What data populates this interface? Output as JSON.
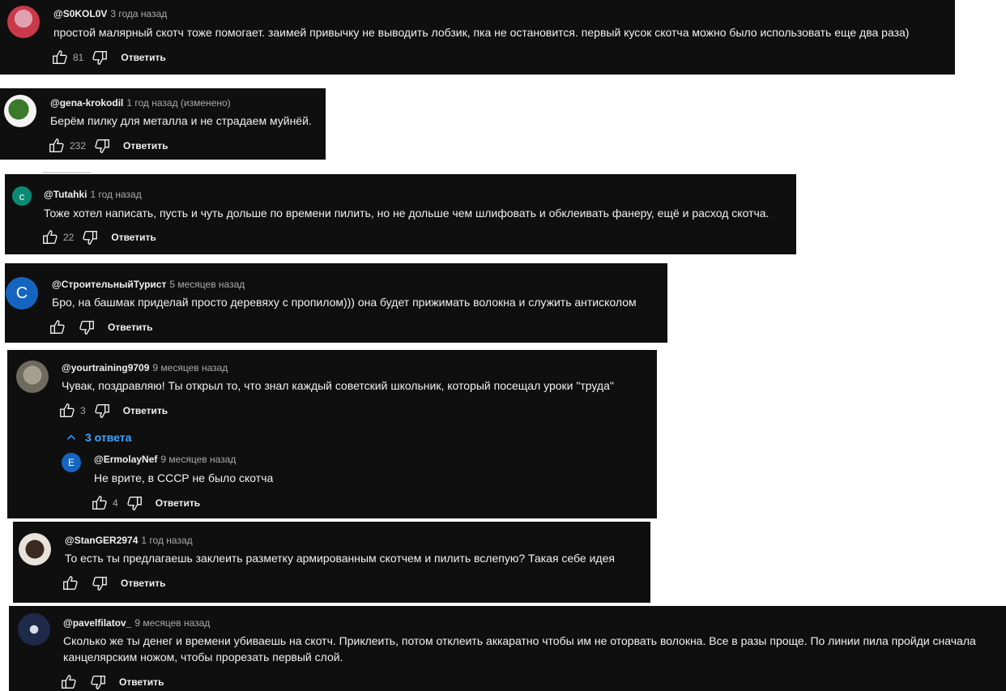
{
  "ui": {
    "reply_label": "Ответить",
    "accent": "#3ea6ff",
    "card_bg": "#0f0f0f"
  },
  "comments": [
    {
      "author": "@S0KOL0V",
      "time": "3 года назад",
      "text": "простой малярный скотч тоже помогает. заимей привычку не выводить лобзик, пка не остановится. первый кусок скотча можно было использовать еще два раза)",
      "likes": "81",
      "avatar": {
        "type": "photo",
        "colors": [
          "#c83a4a",
          "#e0a0b0"
        ]
      }
    },
    {
      "author": "@gena-krokodil",
      "time": "1 год назад (изменено)",
      "text": "Берём пилку для металла и не страдаем муйнёй.",
      "likes": "232",
      "avatar": {
        "type": "photo",
        "colors": [
          "#3a7a2a",
          "#f4f4f4"
        ]
      }
    },
    {
      "author": "@Tutahki",
      "time": "1 год назад",
      "text": "Тоже хотел написать, пусть и чуть дольше по времени пилить, но не дольше чем шлифовать и обклеивать фанеру, ещё и расход скотча.",
      "likes": "22",
      "avatar": {
        "type": "letter",
        "letter": "с",
        "color": "#0b8a73"
      }
    },
    {
      "author": "@СтроительныйТурист",
      "time": "5 месяцев назад",
      "text": "Бро, на башмак приделай просто деревяху с пропилом))) она будет прижимать волокна и служить антисколом",
      "likes": "",
      "avatar": {
        "type": "letter",
        "letter": "С",
        "color": "#1565c0"
      }
    },
    {
      "author": "@yourtraining9709",
      "time": "9 месяцев назад",
      "text": "Чувак, поздравляю! Ты открыл то, что знал каждый советский школьник, который посещал уроки \"труда\"",
      "likes": "3",
      "avatar": {
        "type": "photo",
        "colors": [
          "#6f6a5e",
          "#a59f92"
        ]
      }
    },
    {
      "author": "@StanGER2974",
      "time": "1 год назад",
      "text": "То есть ты предлагаешь заклеить разметку армированным скотчем и пилить вслепую? Такая себе идея",
      "likes": "",
      "avatar": {
        "type": "photo",
        "colors": [
          "#3b2a22",
          "#e8e2dc"
        ]
      }
    },
    {
      "author": "@pavelfilatov_",
      "time": "9 месяцев назад",
      "text": "Сколько же ты денег и времени убиваешь на скотч. Приклеить, потом отклеить аккаратно чтобы им не оторвать волокна. Все в разы проще. По линии пила пройди сначала канцелярским ножом, чтобы прорезать первый слой.",
      "likes": "",
      "avatar": {
        "type": "photo",
        "colors": [
          "#1d2a4a",
          "#d9dde6"
        ]
      }
    }
  ],
  "thread": {
    "replies_label": "3 ответа",
    "reply": {
      "author": "@ErmolayNef",
      "time": "9 месяцев назад",
      "text": "Не врите, в СССР не было скотча",
      "likes": "4",
      "avatar": {
        "type": "letter",
        "letter": "E",
        "color": "#1565c0"
      }
    }
  }
}
